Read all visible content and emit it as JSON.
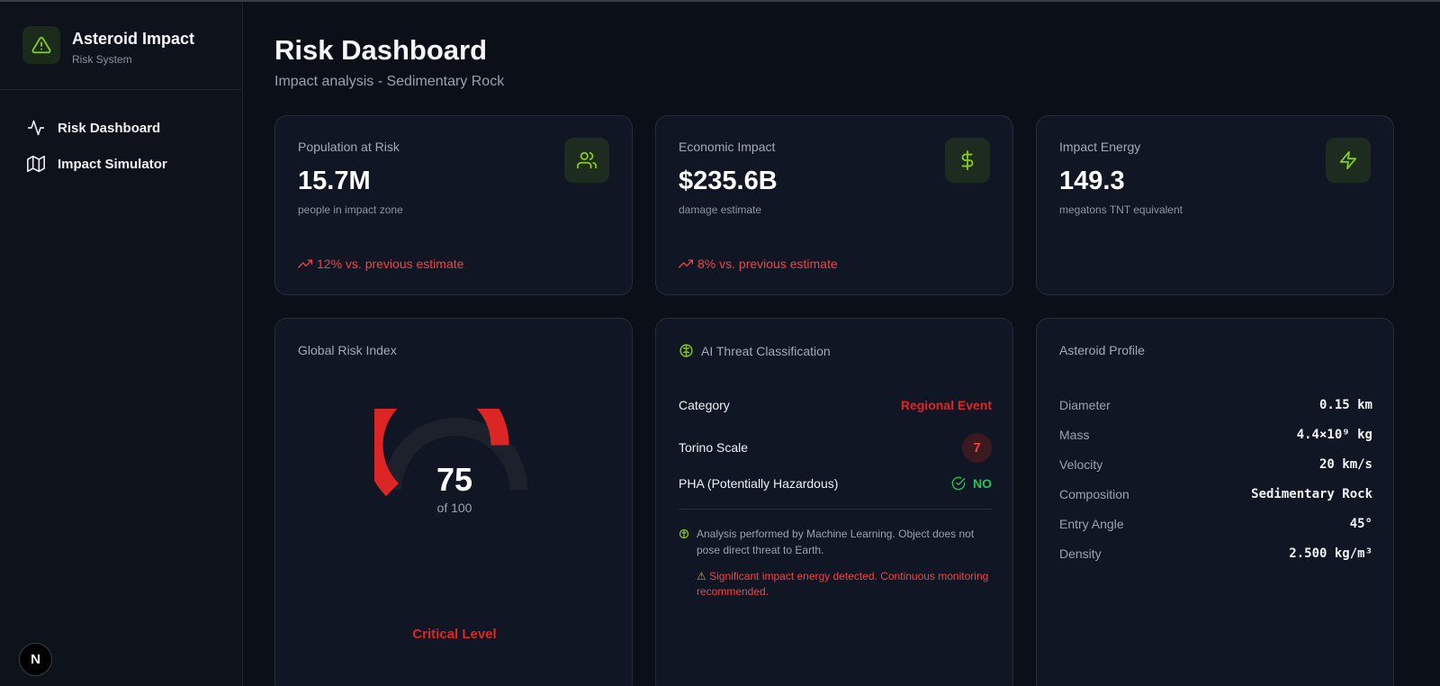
{
  "sidebar": {
    "brand_title": "Asteroid Impact",
    "brand_subtitle": "Risk System",
    "items": [
      {
        "label": "Risk Dashboard",
        "icon": "activity-icon"
      },
      {
        "label": "Impact Simulator",
        "icon": "map-icon"
      }
    ],
    "bottom_badge": "N"
  },
  "header": {
    "title": "Risk Dashboard",
    "subtitle": "Impact analysis - Sedimentary Rock"
  },
  "stats": [
    {
      "label": "Population at Risk",
      "value": "15.7M",
      "desc": "people in impact zone",
      "trend": "12% vs. previous estimate",
      "icon": "users-icon"
    },
    {
      "label": "Economic Impact",
      "value": "$235.6B",
      "desc": "damage estimate",
      "trend": "8% vs. previous estimate",
      "icon": "dollar-icon"
    },
    {
      "label": "Impact Energy",
      "value": "149.3",
      "desc": "megatons TNT equivalent",
      "icon": "zap-icon"
    }
  ],
  "risk_index": {
    "title": "Global Risk Index",
    "value": 75,
    "value_text": "75",
    "of_text": "of 100",
    "level": "Critical Level"
  },
  "threat": {
    "title": "AI Threat Classification",
    "category_label": "Category",
    "category_value": "Regional Event",
    "torino_label": "Torino Scale",
    "torino_value": "7",
    "pha_label": "PHA (Potentially Hazardous)",
    "pha_value": "NO",
    "note": "Analysis performed by Machine Learning. Object does not pose direct threat to Earth.",
    "warning": "Significant impact energy detected. Continuous monitoring recommended."
  },
  "profile": {
    "title": "Asteroid Profile",
    "rows": [
      {
        "k": "Diameter",
        "v": "0.15 km"
      },
      {
        "k": "Mass",
        "v": "4.4×10⁹ kg"
      },
      {
        "k": "Velocity",
        "v": "20 km/s"
      },
      {
        "k": "Composition",
        "v": "Sedimentary Rock"
      },
      {
        "k": "Entry Angle",
        "v": "45°"
      },
      {
        "k": "Density",
        "v": "2.500 kg/m³"
      }
    ]
  },
  "colors": {
    "accent": "#84cc16",
    "danger": "#dc2626",
    "success": "#22c55e"
  }
}
